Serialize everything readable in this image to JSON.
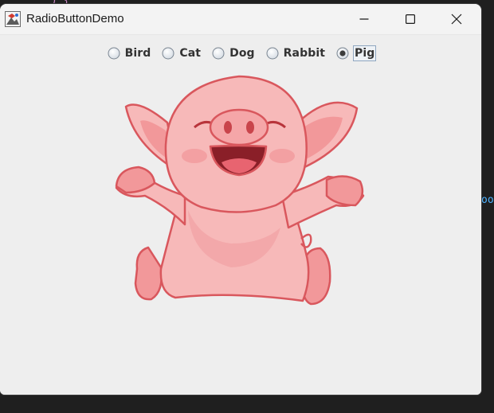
{
  "window": {
    "title": "RadioButtonDemo",
    "minimize_glyph": "—",
    "maximize_glyph": "☐",
    "close_glyph": "✕"
  },
  "background_code": {
    "top_fragment": "  ) {",
    "right_fragment": "oo"
  },
  "radio_group": {
    "selected": "Pig",
    "options": [
      {
        "label": "Bird",
        "checked": false
      },
      {
        "label": "Cat",
        "checked": false
      },
      {
        "label": "Dog",
        "checked": false
      },
      {
        "label": "Rabbit",
        "checked": false
      },
      {
        "label": "Pig",
        "checked": true
      }
    ]
  },
  "image": {
    "subject": "cartoon-pig-icon"
  },
  "colors": {
    "window_bg": "#eeeeee",
    "titlebar_bg": "#f3f3f3",
    "pig_body": "#f7b9b9",
    "pig_outline": "#d9575d",
    "radio_selected": "#3c3c3c"
  }
}
